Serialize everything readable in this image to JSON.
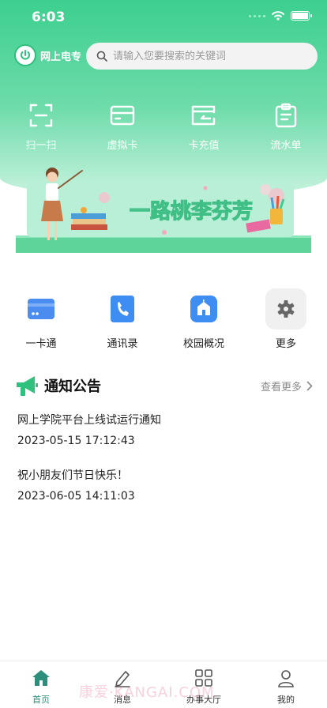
{
  "status_bar": {
    "time": "6:03"
  },
  "header": {
    "brand_name": "网上电专",
    "search_placeholder": "请输入您要搜索的关键词"
  },
  "quick_actions": [
    {
      "label": "扫一扫",
      "icon": "scan-icon"
    },
    {
      "label": "虚拟卡",
      "icon": "card-icon"
    },
    {
      "label": "卡充值",
      "icon": "recharge-icon"
    },
    {
      "label": "流水单",
      "icon": "clipboard-icon"
    }
  ],
  "banner": {
    "text": "一路桃李芬芳"
  },
  "services": [
    {
      "label": "一卡通",
      "icon": "campus-card-icon",
      "color": "#4a8cf0"
    },
    {
      "label": "通讯录",
      "icon": "phone-book-icon",
      "color": "#3d8df2"
    },
    {
      "label": "校园概况",
      "icon": "school-icon",
      "color": "#3d8df2"
    },
    {
      "label": "更多",
      "icon": "gear-icon",
      "color": "#f0f0f0"
    }
  ],
  "notices": {
    "title": "通知公告",
    "more_label": "查看更多",
    "items": [
      {
        "title": "网上学院平台上线试运行通知",
        "date": "2023-05-15 17:12:43"
      },
      {
        "title": "祝小朋友们节日快乐！",
        "date": "2023-06-05 14:11:03"
      }
    ]
  },
  "tabbar": [
    {
      "label": "首页",
      "icon": "home-icon",
      "active": true
    },
    {
      "label": "消息",
      "icon": "pen-icon",
      "active": false
    },
    {
      "label": "办事大厅",
      "icon": "grid-icon",
      "active": false
    },
    {
      "label": "我的",
      "icon": "user-icon",
      "active": false
    }
  ],
  "watermark": "康爱·KANGAI.COM",
  "colors": {
    "brand_green": "#3ccf8f",
    "accent_blue": "#3d8df2",
    "active_tab": "#2d8f7b"
  }
}
